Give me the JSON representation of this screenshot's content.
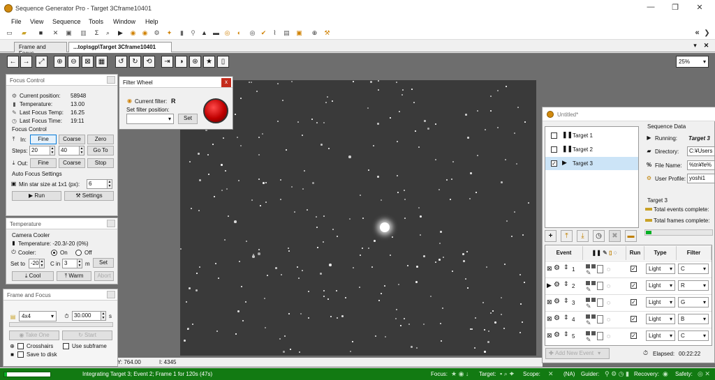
{
  "app": {
    "title": "Sequence Generator Pro - Target 3Cframe10401",
    "win_minimize": "—",
    "win_restore": "❐",
    "win_close": "✕"
  },
  "menu": [
    "File",
    "View",
    "Sequence",
    "Tools",
    "Window",
    "Help"
  ],
  "tabs": [
    {
      "label": "Frame and Focus"
    },
    {
      "label": "...top\\sgp\\Target 3Cframe10401"
    }
  ],
  "toolbar": {
    "zoom": "25%",
    "tab_close": "✕",
    "tab_menu": "▾",
    "nav_left": "«",
    "nav_right": "❯"
  },
  "focus_control": {
    "title": "Focus Control",
    "current_position_label": "Current position:",
    "current_position": "58948",
    "temperature_label": "Temperature:",
    "temperature": "13.00",
    "last_focus_temp_label": "Last Focus Temp:",
    "last_focus_temp": "16.25",
    "last_focus_time_label": "Last Focus Time:",
    "last_focus_time": "19:11",
    "group_label": "Focus Control",
    "in_label": "In:",
    "fine": "Fine",
    "coarse": "Coarse",
    "zero": "Zero",
    "steps_label": "Steps:",
    "steps_fine": "20",
    "steps_coarse": "40",
    "goto": "Go To",
    "out_label": "Out:",
    "stop": "Stop",
    "auto_group": "Auto Focus Settings",
    "min_star_label": "Min star size at 1x1 (px):",
    "min_star": "6",
    "run": "Run",
    "settings": "Settings"
  },
  "filter_wheel": {
    "title": "Filter Wheel",
    "current_filter_label": "Current filter:",
    "current_filter": "R",
    "set_filter_label": "Set filter position:",
    "set": "Set",
    "close": "x",
    "indicator_color": "#c00000"
  },
  "temperature_panel": {
    "title": "Temperature",
    "group_label": "Camera Cooler",
    "temperature_text": "Temperature: -20.3/-20 (0%)",
    "cooler_label": "Cooler:",
    "on": "On",
    "off": "Off",
    "set_to_label": "Set to",
    "set_to_value": "-20",
    "c_in_label": "C in",
    "minutes_value": "3",
    "m_label": "m",
    "set": "Set",
    "cool": "Cool",
    "warm": "Warm",
    "abort": "Abort"
  },
  "frame_focus": {
    "title": "Frame and Focus",
    "binning": "4x4",
    "exposure": "30.000",
    "exposure_unit": "s",
    "take_one": "Take One",
    "start": "Start",
    "crosshairs": "Crosshairs",
    "use_subframe": "Use subframe",
    "save_to_disk": "Save to disk"
  },
  "coords": {
    "y": "Y: 764.00",
    "i": "I: 4345"
  },
  "sequence": {
    "title": "Untitled*",
    "targets": [
      {
        "name": "Target 1",
        "checked": false,
        "state": "paused"
      },
      {
        "name": "Target 2",
        "checked": false,
        "state": "paused"
      },
      {
        "name": "Target 3",
        "checked": true,
        "state": "running"
      }
    ],
    "data_title": "Sequence Data",
    "running_label": "Running:",
    "running_value": "Target 3",
    "directory_label": "Directory:",
    "directory_value": "C:¥Users",
    "file_name_label": "File Name:",
    "file_name_value": "%tn¥fe%",
    "user_profile_label": "User Profile:",
    "user_profile_value": "yoshi1",
    "target_heading": "Target 3",
    "total_events_label": "Total events complete:",
    "total_frames_label": "Total frames complete:",
    "frames_progress": 0.08,
    "headers": {
      "event": "Event",
      "run": "Run",
      "type": "Type",
      "filter": "Filter"
    },
    "events": [
      {
        "num": "1",
        "type": "Light",
        "filter": "C",
        "checked": true,
        "active": false
      },
      {
        "num": "2",
        "type": "Light",
        "filter": "R",
        "checked": true,
        "active": true
      },
      {
        "num": "3",
        "type": "Light",
        "filter": "G",
        "checked": true,
        "active": false
      },
      {
        "num": "4",
        "type": "Light",
        "filter": "B",
        "checked": true,
        "active": false
      },
      {
        "num": "5",
        "type": "Light",
        "filter": "C",
        "checked": true,
        "active": false
      }
    ],
    "add_new_event": "Add New Event",
    "elapsed_label": "Elapsed:",
    "elapsed_value": "00:22:22"
  },
  "status": {
    "message": "Integrating Target 3; Event 2; Frame 1 for 120s (47s)",
    "focus_label": "Focus:",
    "target_label": "Target:",
    "scope_label": "Scope:",
    "scope_value": "(NA)",
    "guider_label": "Guider:",
    "recovery_label": "Recovery:",
    "safety_label": "Safety:",
    "progress": 0.06
  },
  "colors": {
    "status_green": "#127a12",
    "selection_blue": "#cce4f7",
    "progress_green": "#06b025"
  }
}
